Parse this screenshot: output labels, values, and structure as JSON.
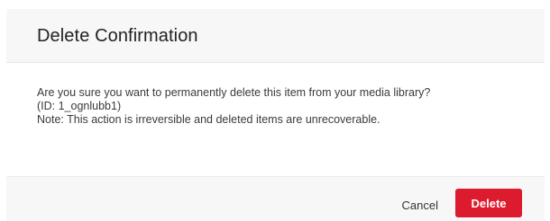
{
  "dialog": {
    "title": "Delete Confirmation",
    "message_line1": "Are you sure you want to permanently delete this item from your media library?",
    "message_line2": "(ID: 1_ognlubb1)",
    "message_line3": "Note: This action is irreversible and deleted items are unrecoverable.",
    "cancel_label": "Cancel",
    "delete_label": "Delete"
  },
  "colors": {
    "delete_button": "#dc1c2e",
    "header_background": "#f7f7f7",
    "footer_background": "#f7f7f7"
  }
}
